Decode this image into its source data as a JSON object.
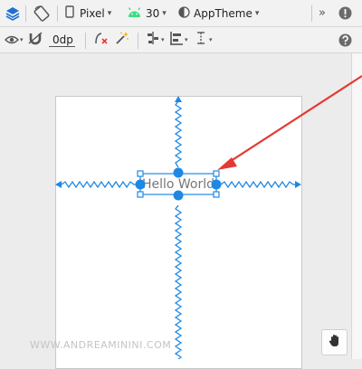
{
  "toolbar_top": {
    "device_label": "Pixel",
    "api_label": "30",
    "theme_label": "AppTheme",
    "overflow_label": "»"
  },
  "toolbar_second": {
    "margin_value": "0dp"
  },
  "canvas": {
    "textview_text": "Hello World"
  },
  "watermark": "WWW.ANDREAMININI.COM",
  "colors": {
    "constraint_blue": "#1e88e5",
    "arrow_red": "#e53935",
    "android_green": "#3ddc84"
  }
}
